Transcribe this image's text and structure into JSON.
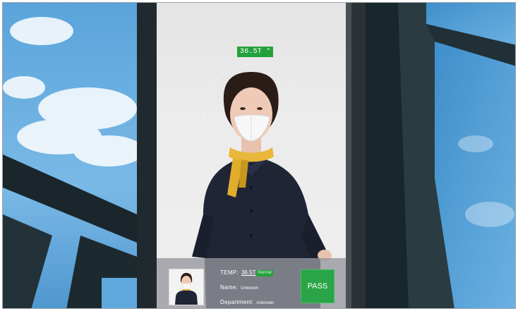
{
  "scan": {
    "temperature_badge": "36.5T °"
  },
  "record": {
    "temp_label": "TEMP:",
    "temp_value": "36.5T",
    "temp_status": "Normal",
    "name_label": "Name:",
    "name_value": "Unknown",
    "department_label": "Department:",
    "department_value": "Unknown"
  },
  "actions": {
    "pass_label": "PASS"
  },
  "colors": {
    "accent_green": "#24a13c",
    "sky_blue": "#5fa9df",
    "frame_dark": "#1c2b30"
  }
}
